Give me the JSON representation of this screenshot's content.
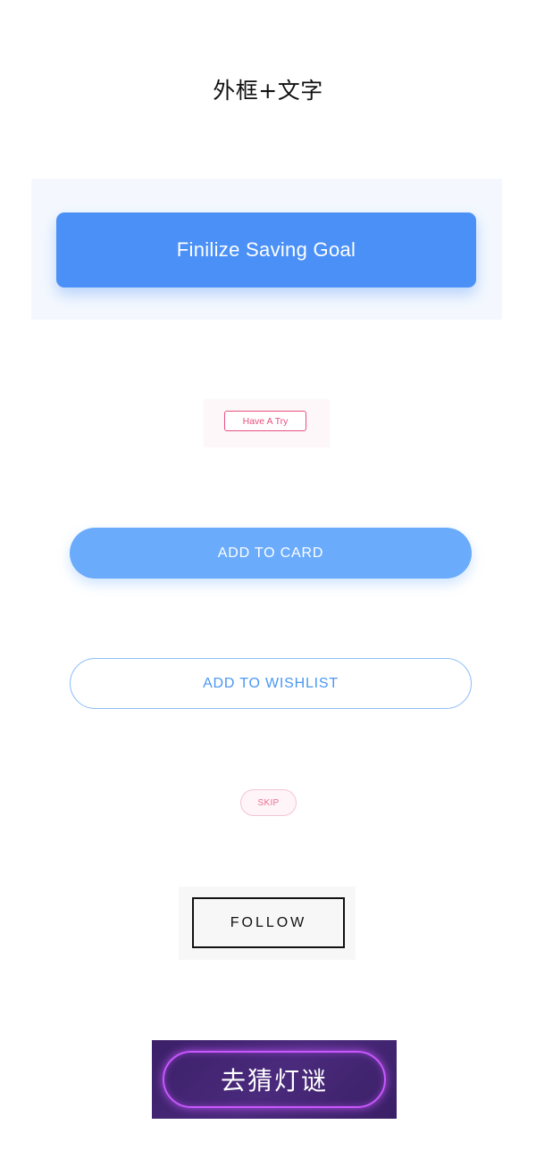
{
  "page": {
    "title": "外框+文字"
  },
  "buttons": {
    "finalize": "Finilize Saving Goal",
    "have_a_try": "Have A Try",
    "add_to_card": "ADD TO CARD",
    "add_to_wishlist": "ADD TO WISHLIST",
    "skip": "SKIP",
    "follow": "FOLLOW",
    "guess_riddle": "去猜灯谜"
  },
  "colors": {
    "primary_blue": "#4a90f7",
    "light_blue": "#6aabfb",
    "wishlist_blue": "#4a97f3",
    "pink": "#e8507f",
    "skip_pink": "#e86f95",
    "follow_black": "#111111",
    "neon_purple": "#c957ff",
    "purple_panel": "#3b2068"
  }
}
